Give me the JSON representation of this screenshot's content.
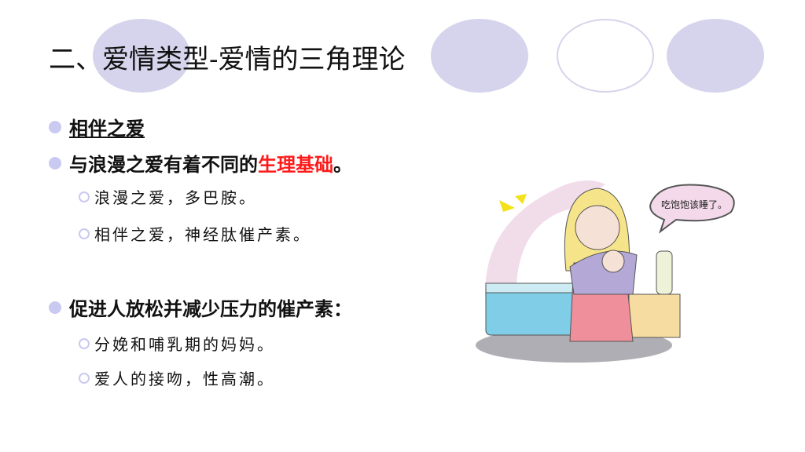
{
  "title": "二、爱情类型-爱情的三角理论",
  "colors": {
    "accent": "#d6d4ec",
    "highlight": "#ff1a1a",
    "bullet": "#c9c9f2"
  },
  "bullets": [
    {
      "text": "相伴之爱"
    },
    {
      "text": "与浪漫之爱有着不同的",
      "highlight": "生理基础",
      "end": "。",
      "sub": [
        "浪漫之爱，多巴胺。",
        "相伴之爱，神经肽催产素。"
      ]
    },
    {
      "text": "促进人放松并减少压力的催产素：",
      "sub": [
        "分娩和哺乳期的妈妈。",
        "爱人的接吻，性高潮。"
      ]
    }
  ],
  "illustration": {
    "speech_bubble": "吃饱饱该睡了。"
  }
}
